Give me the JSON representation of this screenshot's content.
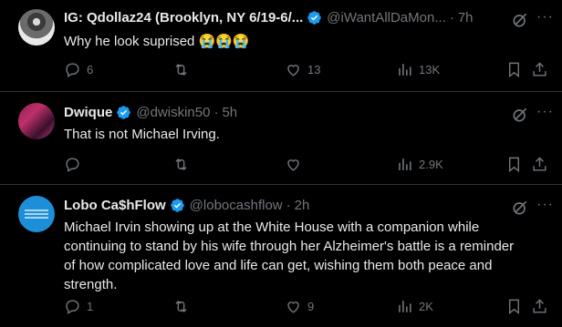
{
  "tweets": [
    {
      "name": "IG: Qdollaz24 (Brooklyn, NY 6/19-6/...",
      "handle": "@iWantAllDaMon...",
      "dot": "·",
      "time": "7h",
      "text": "Why he look suprised 😭😭😭",
      "replies": "6",
      "retweets": "",
      "likes": "13",
      "views": "13K"
    },
    {
      "name": "Dwique",
      "handle": "@dwiskin50",
      "dot": "·",
      "time": "5h",
      "text": "That is not Michael Irving.",
      "replies": "",
      "retweets": "",
      "likes": "",
      "views": "2.9K"
    },
    {
      "name": "Lobo Ca$hFlow",
      "handle": "@lobocashflow",
      "dot": "·",
      "time": "2h",
      "text_lines": [
        "Michael Irvin showing up at the White House with a companion while",
        "continuing to stand by his wife through her Alzheimer's battle is a reminder",
        "of how complicated love and life can get, wishing them both peace and",
        "strength."
      ],
      "replies": "1",
      "retweets": "",
      "likes": "9",
      "views": "2K"
    }
  ],
  "colors": {
    "accent": "#1d9bf0",
    "muted": "#71767b",
    "text": "#e7e9ea",
    "border": "#2f3336"
  },
  "icons": [
    "verified-badge-icon",
    "grok-icon",
    "more-icon",
    "reply-icon",
    "retweet-icon",
    "like-icon",
    "views-icon",
    "bookmark-icon",
    "share-icon"
  ]
}
